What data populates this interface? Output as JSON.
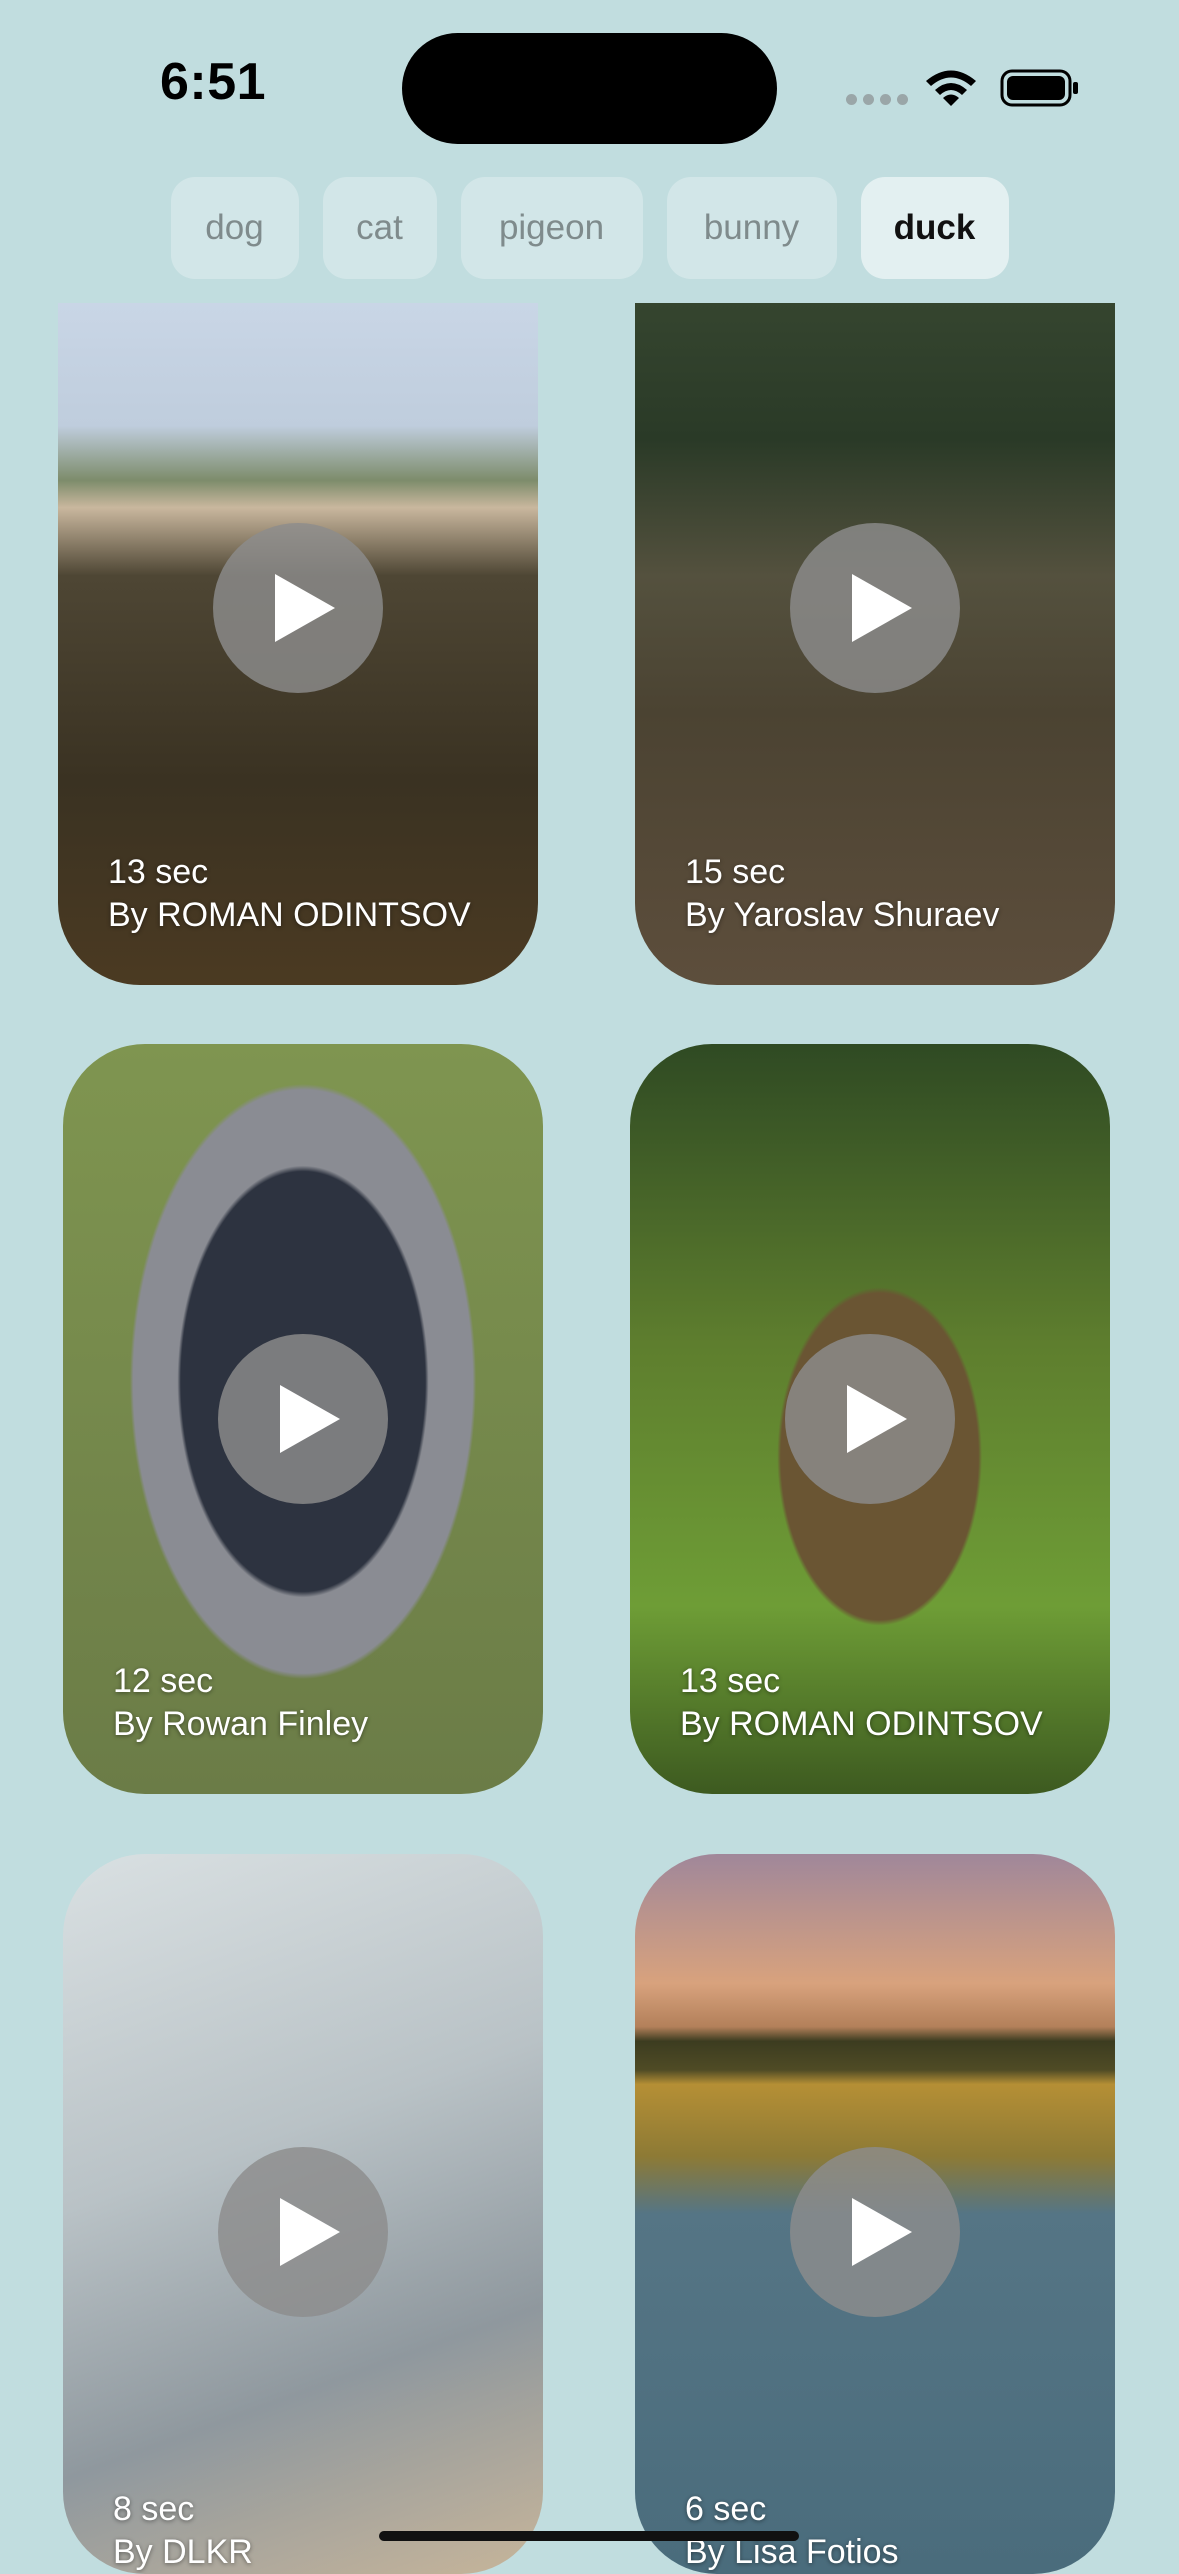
{
  "status_bar": {
    "time": "6:51"
  },
  "categories": [
    {
      "label": "dog",
      "active": false
    },
    {
      "label": "cat",
      "active": false
    },
    {
      "label": "pigeon",
      "active": false
    },
    {
      "label": "bunny",
      "active": false
    },
    {
      "label": "duck",
      "active": true
    }
  ],
  "videos": [
    {
      "duration": "13 sec",
      "author": "By ROMAN ODINTSOV"
    },
    {
      "duration": "15 sec",
      "author": "By Yaroslav Shuraev"
    },
    {
      "duration": "12 sec",
      "author": "By Rowan  Finley"
    },
    {
      "duration": "13 sec",
      "author": "By ROMAN ODINTSOV"
    },
    {
      "duration": "8 sec",
      "author": "By DLKR"
    },
    {
      "duration": "6 sec",
      "author": "By Lisa Fotios"
    }
  ],
  "colors": {
    "background": "#c1dddf",
    "chip_inactive_text": "#7f8b8c",
    "chip_active_text": "#111111"
  },
  "icons": {
    "wifi": "wifi-icon",
    "battery": "battery-icon",
    "play": "play-icon"
  }
}
